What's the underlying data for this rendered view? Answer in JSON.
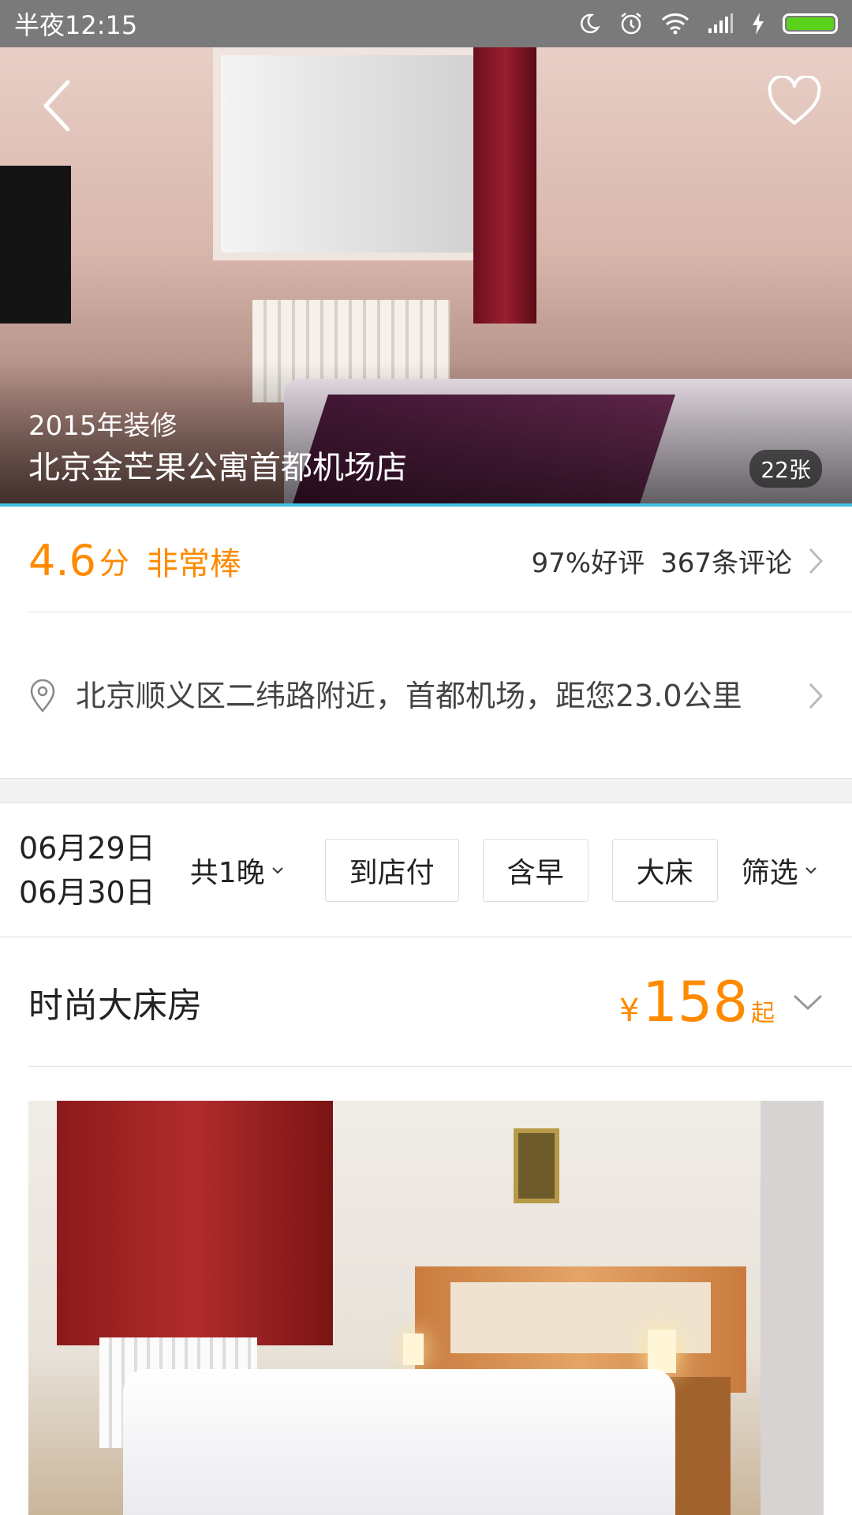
{
  "status_bar": {
    "time": "半夜12:15",
    "icons": [
      "moon-icon",
      "alarm-icon",
      "wifi-icon",
      "signal-icon",
      "charging-icon",
      "battery-icon"
    ],
    "battery_color": "#5ad11a",
    "battery_level": 1.0
  },
  "hero": {
    "renovation": "2015年装修",
    "hotel_name": "北京金芒果公寓首都机场店",
    "photo_count": "22张",
    "accent_color": "#3fc0df"
  },
  "rating": {
    "score": "4.6",
    "score_unit": "分",
    "score_word": "非常棒",
    "positive_rate": "97%好评",
    "review_count": "367条评论",
    "accent_color": "#ff8a00"
  },
  "location": {
    "text": "北京顺义区二纬路附近，首都机场，距您23.0公里"
  },
  "filters": {
    "checkin": "06月29日",
    "checkout": "06月30日",
    "nights": "共1晚",
    "tags": [
      "到店付",
      "含早",
      "大床"
    ],
    "filter_label": "筛选"
  },
  "room": {
    "name": "时尚大床房",
    "currency": "¥",
    "price": "158",
    "price_suffix": "起"
  }
}
